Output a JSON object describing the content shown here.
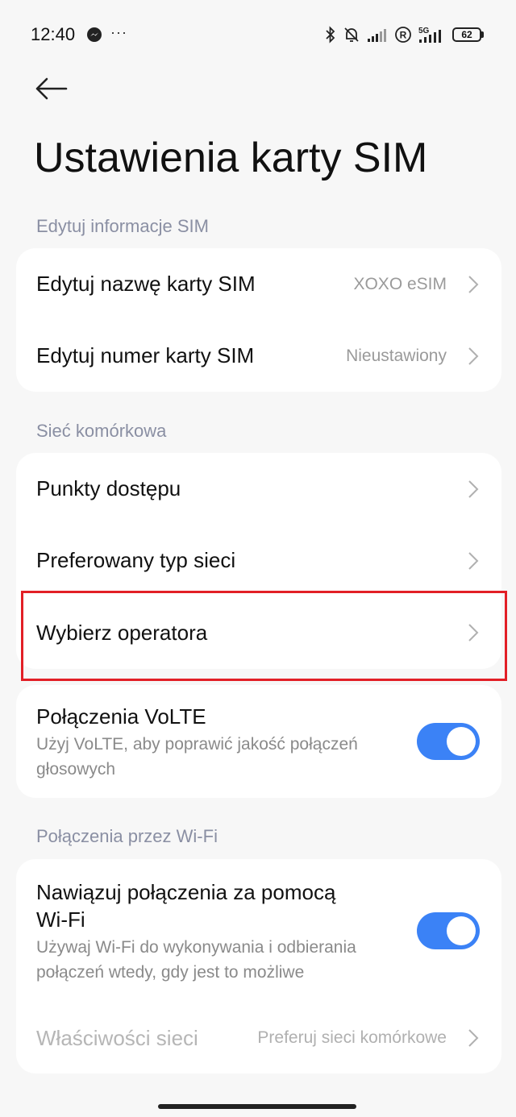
{
  "status_bar": {
    "time": "12:40",
    "more": "···",
    "battery": "62",
    "network": "5G"
  },
  "header": {
    "title": "Ustawienia karty SIM"
  },
  "sections": {
    "sim_info": {
      "label": "Edytuj informacje SIM",
      "items": [
        {
          "label": "Edytuj nazwę karty SIM",
          "value": "XOXO eSIM"
        },
        {
          "label": "Edytuj numer karty SIM",
          "value": "Nieustawiony"
        }
      ]
    },
    "mobile_network": {
      "label": "Sieć komórkowa",
      "items": [
        {
          "label": "Punkty dostępu"
        },
        {
          "label": "Preferowany typ sieci"
        },
        {
          "label": "Wybierz operatora"
        }
      ]
    },
    "volte": {
      "label": "Połączenia VoLTE",
      "sub_line1": "Użyj VoLTE, aby poprawić jakość połączeń",
      "sub_line2": "głosowych",
      "enabled": true
    },
    "wifi_calling": {
      "label": "Połączenia przez Wi-Fi",
      "toggle_line1": "Nawiązuj połączenia za pomocą",
      "toggle_line2": "Wi-Fi",
      "sub_line1": "Używaj Wi-Fi do wykonywania i odbierania",
      "sub_line2": "połączeń wtedy, gdy jest to możliwe",
      "enabled": true,
      "network_props_label": "Właściwości sieci",
      "network_props_value": "Preferuj sieci komórkowe"
    }
  },
  "colors": {
    "accent": "#3b82f6",
    "highlight": "#e21f26",
    "background": "#f7f7f7"
  }
}
